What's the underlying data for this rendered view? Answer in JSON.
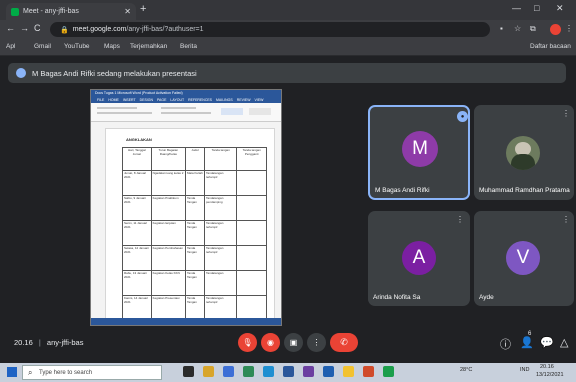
{
  "browser": {
    "tab_title": "Meet - any-jffi-bas",
    "new_tab": "+",
    "url_host": "meet.google.com",
    "url_path": "/any-jffi-bas/?authuser=1",
    "nav": {
      "back": "←",
      "forward": "→",
      "reload": "C"
    },
    "window_controls": [
      "—",
      "□",
      "✕"
    ],
    "bookmarks": [
      "Apl",
      "Gmail",
      "YouTube",
      "Maps",
      "Terjemahkan",
      "Berita"
    ],
    "reading_list": "Daftar bacaan"
  },
  "banner": {
    "text": "M Bagas Andi Rifki sedang melakukan presentasi"
  },
  "presentation": {
    "word_title": "Docs Tugas 1 Microsoft Word (Product Activation Failed)",
    "word_tabs": [
      "FILE",
      "HOME",
      "INSERT",
      "DESIGN",
      "PAGE LAYOUT",
      "REFERENCES",
      "MAILINGS",
      "REVIEW",
      "VIEW"
    ],
    "doc_heading": "ANGKLAKAN",
    "table_header": [
      "Hari, Tanggal Jumat",
      "Turun Bagaian Ruang/Kelas",
      "Judul",
      "Tanda tangan",
      "Tanda tangan Pengganti"
    ],
    "table_rows": [
      [
        "Jumat, 8 Januari 2021",
        "Ngadalat ruang kelas 2",
        "Mata Kuliah",
        "Tandatangan terlampir"
      ],
      [
        "Sabtu, 9 Januari 2021",
        "Kegiatan Praktikum",
        "Tanda Tangan",
        "Tandatangan pendamping"
      ],
      [
        "Senin, 11 Januari 2021",
        "Kegiatan lanjutan",
        "Tanda Tangan",
        "Tandatangan terlampir"
      ],
      [
        "Selasa, 12 Januari 2021",
        "Kegiatan Pembahasan",
        "Tanda Tangan",
        "Tandatangan terlampir"
      ],
      [
        "Rabu, 13 Januari 2021",
        "Kegiatan Kelas KKN",
        "Tanda Tangan",
        "Tandatangan"
      ],
      [
        "Kamis, 14 Januari 2021",
        "Kegiatan Presentasi",
        "Tanda Tangan",
        "Tandatangan terlampir"
      ]
    ]
  },
  "participants": [
    {
      "name": "M Bagas Andi Rifki",
      "initial": "M",
      "color": "#8e3ba8"
    },
    {
      "name": "Muhammad Ramdhan Pratama",
      "initial": ""
    },
    {
      "name": "Arinda Nofita Sa",
      "initial": "A",
      "color": "#7b1fa2"
    },
    {
      "name": "Ayde",
      "initial": "V",
      "color": "#7e57c2"
    }
  ],
  "meeting": {
    "time": "20.16",
    "code": "any-jffi-bas",
    "people_count": "6"
  },
  "controls": {
    "mic": "🎙",
    "cam": "◉",
    "present": "▣",
    "more": "⋮",
    "end": "✆"
  },
  "right_icons": {
    "info": "ⓘ",
    "people": "👤",
    "chat": "💬",
    "activities": "△"
  },
  "taskbar": {
    "search_placeholder": "Type here to search",
    "tray_weather": "28°C",
    "tray_time": "20.16",
    "tray_date": "13/12/2021",
    "tray_lang": "IND"
  }
}
